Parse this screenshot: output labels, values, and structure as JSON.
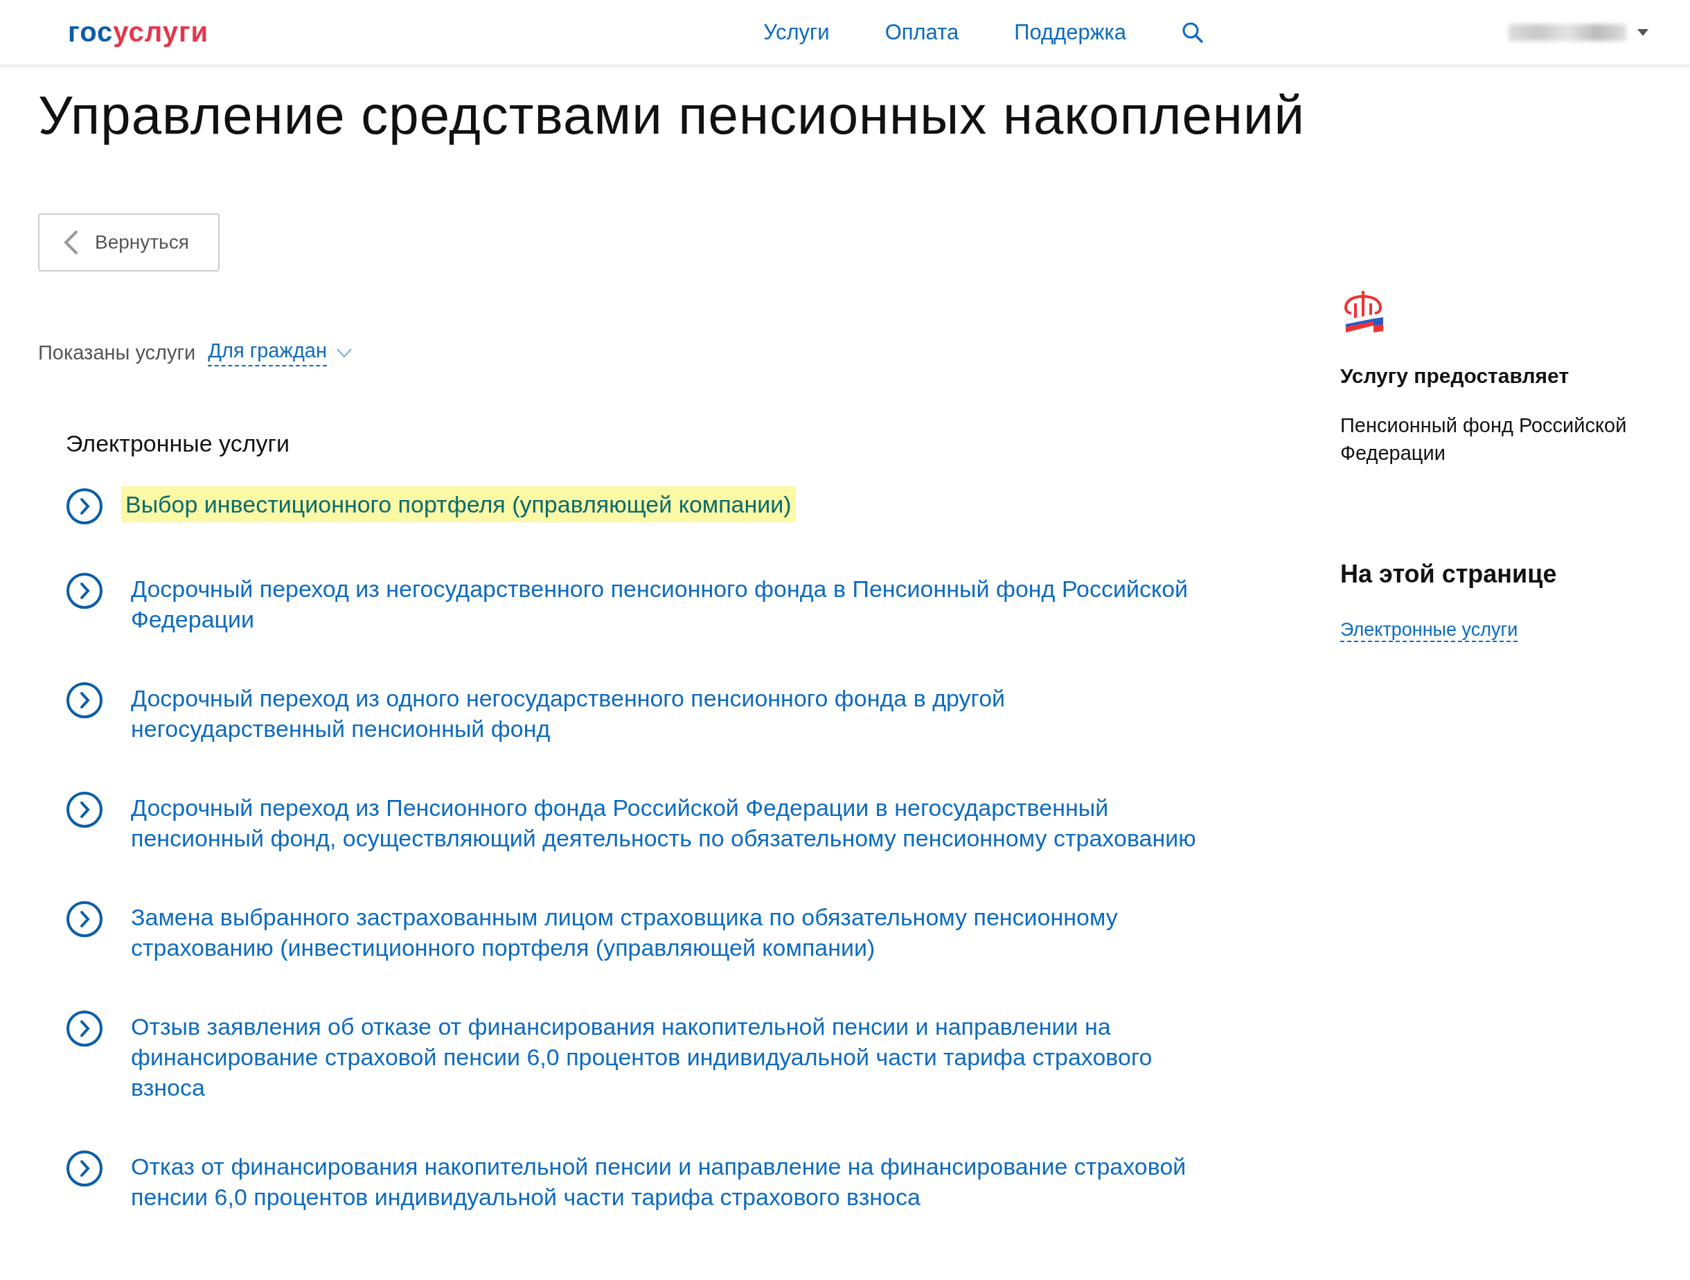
{
  "header": {
    "logo": {
      "part_1": "гос",
      "part_2": "услуги"
    },
    "nav": [
      "Услуги",
      "Оплата",
      "Поддержка"
    ]
  },
  "title": "Управление средствами пенсионных накоплений",
  "back_button": "Вернуться",
  "filter": {
    "label": "Показаны услуги",
    "value": "Для граждан"
  },
  "section_title": "Электронные услуги",
  "services": [
    {
      "text": "Выбор инвестиционного портфеля (управляющей компании)",
      "highlighted": true
    },
    {
      "text": "Досрочный переход из негосударственного пенсионного фонда в Пенсионный фонд Российской Федерации",
      "highlighted": false
    },
    {
      "text": "Досрочный переход из одного негосударственного пенсионного фонда в другой негосударственный пенсионный фонд",
      "highlighted": false
    },
    {
      "text": "Досрочный переход из Пенсионного фонда Российской Федерации в негосударственный пенсионный фонд, осуществляющий деятельность по обязательному пенсионному страхованию",
      "highlighted": false
    },
    {
      "text": "Замена выбранного застрахованным лицом страховщика по обязательному пенсионному страхованию (инвестиционного портфеля (управляющей компании)",
      "highlighted": false
    },
    {
      "text": "Отзыв заявления об отказе от финансирования накопительной пенсии и направлении на финансирование страховой пенсии 6,0 процентов индивидуальной части тарифа страхового взноса",
      "highlighted": false
    },
    {
      "text": "Отказ от финансирования накопительной пенсии и направление на финансирование страховой пенсии 6,0 процентов индивидуальной части тарифа страхового взноса",
      "highlighted": false
    }
  ],
  "sidebar": {
    "provider_heading": "Услугу предоставляет",
    "provider": "Пенсионный фонд Российской Федерации",
    "on_page_heading": "На этой странице",
    "on_page_links": [
      "Электронные услуги"
    ]
  }
}
